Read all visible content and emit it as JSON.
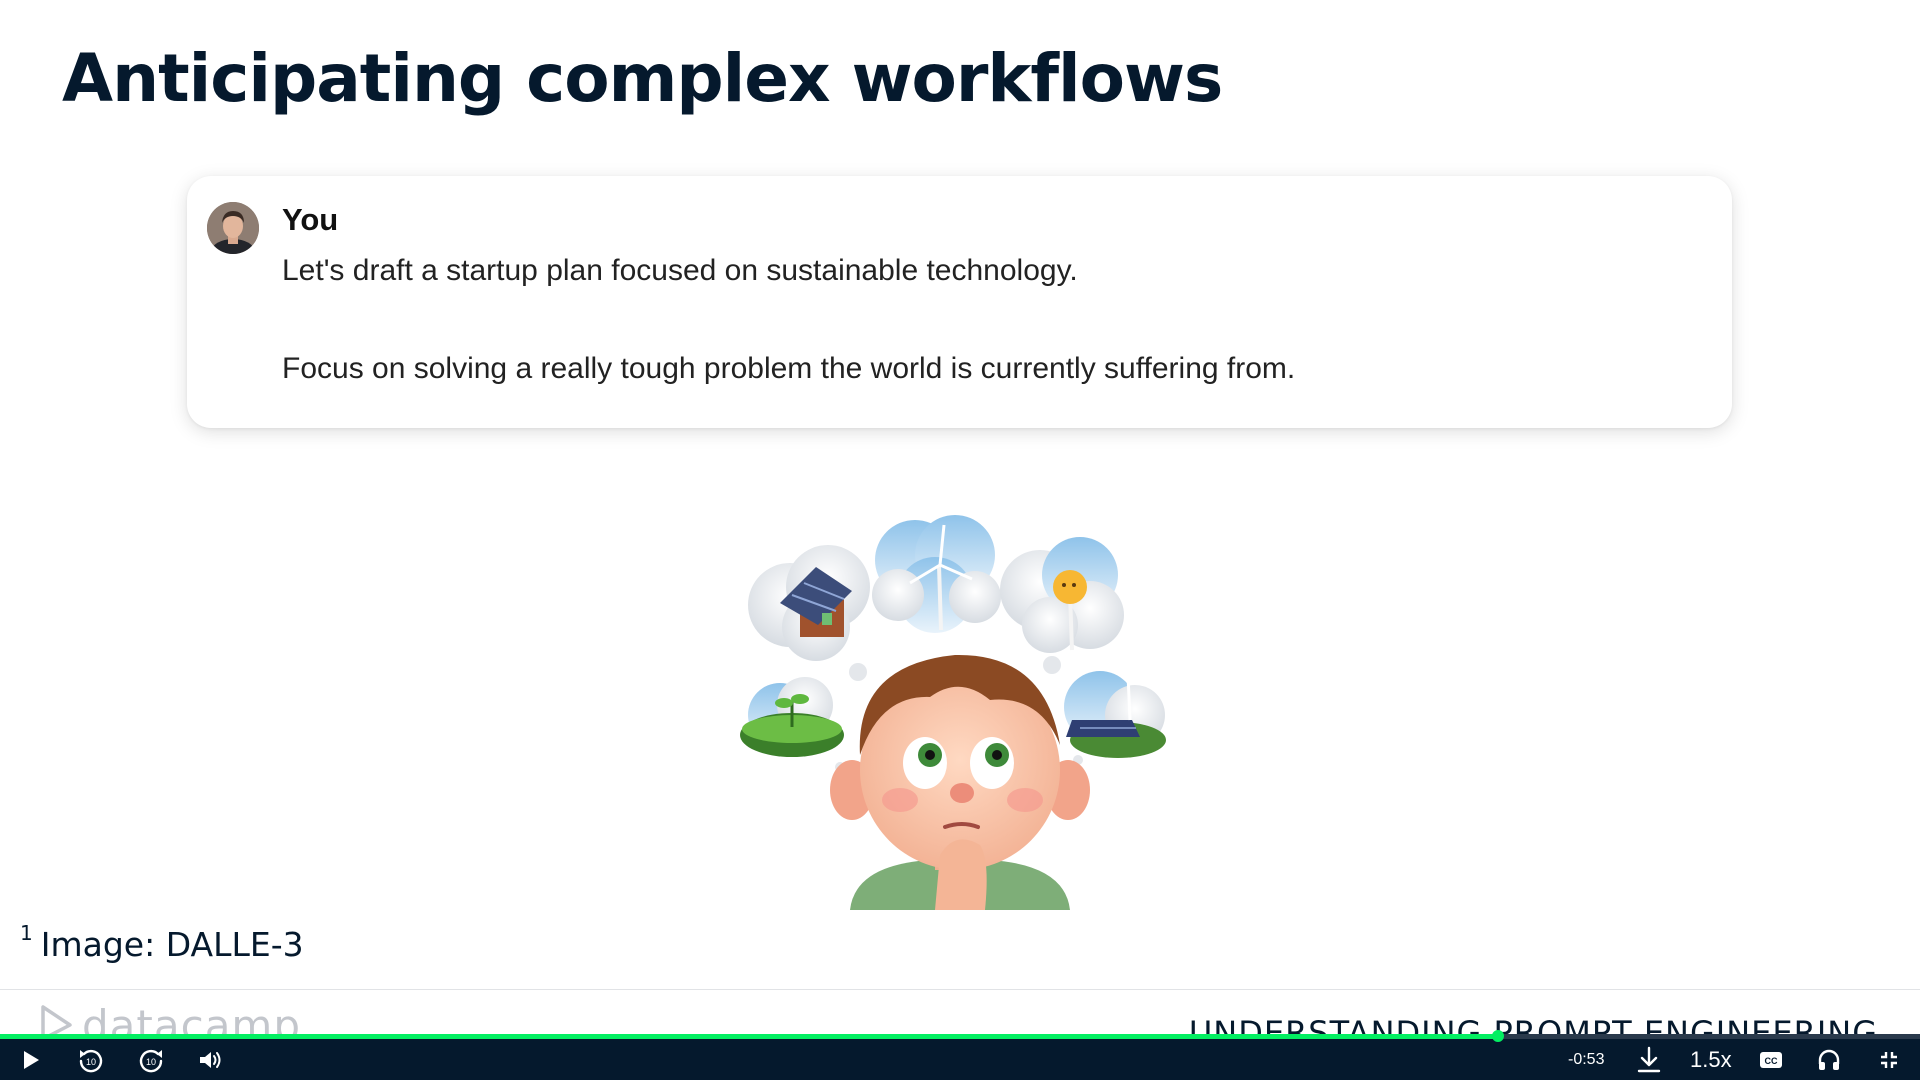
{
  "slide": {
    "title": "Anticipating complex workflows",
    "chat": {
      "sender": "You",
      "messages": [
        "Let's draft a startup plan focused on sustainable technology.",
        "Focus on solving a really tough problem the world is currently suffering from."
      ]
    },
    "footnote": {
      "marker": "1",
      "text": "Image: DALLE-3"
    },
    "footer": {
      "brand": "datacamp",
      "course": "UNDERSTANDING PROMPT ENGINEERING"
    }
  },
  "player": {
    "progress": 0.78,
    "time_remaining": "-0:53",
    "speed": "1.5x",
    "skip_back_seconds": "10",
    "skip_forward_seconds": "10",
    "icons": [
      "play-icon",
      "rewind-10-icon",
      "forward-10-icon",
      "volume-icon",
      "download-icon",
      "captions-icon",
      "headphones-icon",
      "exit-fullscreen-icon"
    ]
  },
  "colors": {
    "title": "#05192d",
    "accent": "#03ef62",
    "controls_bg": "#05192d"
  }
}
